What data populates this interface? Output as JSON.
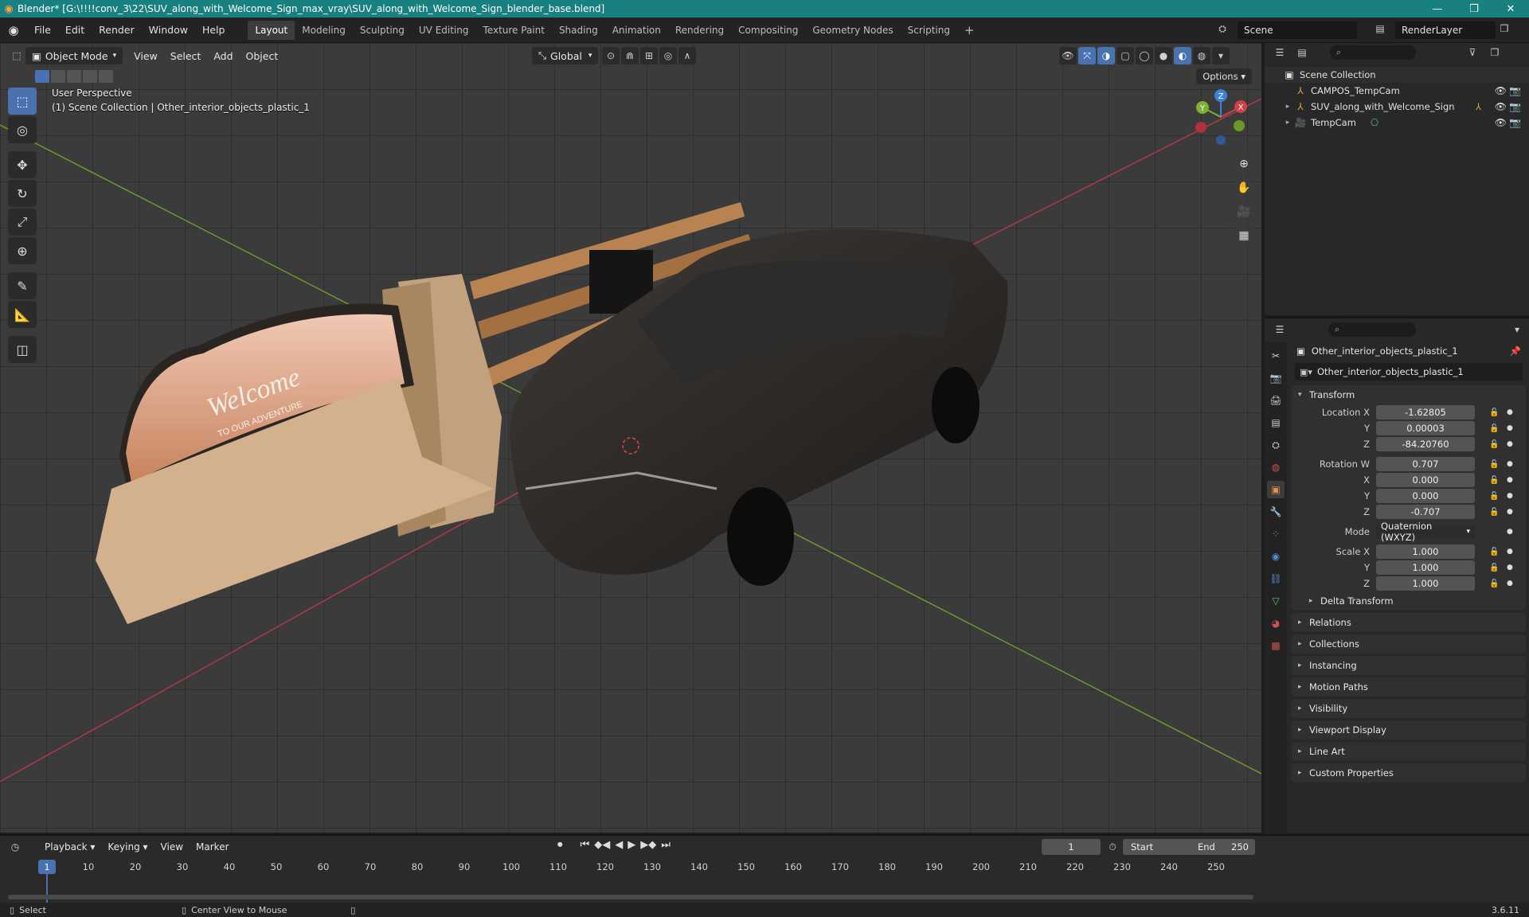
{
  "titlebar": {
    "title": "Blender* [G:\\!!!!conv_3\\22\\SUV_along_with_Welcome_Sign_max_vray\\SUV_along_with_Welcome_Sign_blender_base.blend]",
    "minimize": "—",
    "maximize": "❐",
    "close": "✕"
  },
  "menubar": {
    "menus": [
      "File",
      "Edit",
      "Render",
      "Window",
      "Help"
    ],
    "workspaces": [
      "Layout",
      "Modeling",
      "Sculpting",
      "UV Editing",
      "Texture Paint",
      "Shading",
      "Animation",
      "Rendering",
      "Compositing",
      "Geometry Nodes",
      "Scripting"
    ],
    "active_workspace": "Layout",
    "add_workspace": "+",
    "scene": "Scene",
    "view_layer": "RenderLayer"
  },
  "viewport": {
    "mode": "Object Mode",
    "menus": [
      "View",
      "Select",
      "Add",
      "Object"
    ],
    "orientation": "Global",
    "options": "Options",
    "perspective": "User Perspective",
    "collection_info": "(1) Scene Collection | Other_interior_objects_plastic_1",
    "sign_text": "Welcome",
    "sign_subtext": "TO OUR ADVENTURE",
    "gizmo": {
      "x": "X",
      "y": "Y",
      "z": "Z"
    }
  },
  "outliner": {
    "root": "Scene Collection",
    "items": [
      {
        "name": "CAMPOS_TempCam",
        "expand": ""
      },
      {
        "name": "SUV_along_with_Welcome_Sign",
        "expand": "▸"
      },
      {
        "name": "TempCam",
        "expand": "▸"
      }
    ]
  },
  "properties": {
    "object_name": "Other_interior_objects_plastic_1",
    "data_name": "Other_interior_objects_plastic_1",
    "transform_title": "Transform",
    "location": {
      "label": "Location X",
      "x": "-1.62805",
      "y": "0.00003",
      "z": "-84.20760"
    },
    "rotation": {
      "label": "Rotation W",
      "w": "0.707",
      "x": "0.000",
      "y": "0.000",
      "z": "-0.707"
    },
    "mode_label": "Mode",
    "mode_value": "Quaternion (WXYZ)",
    "scale": {
      "label": "Scale X",
      "x": "1.000",
      "y": "1.000",
      "z": "1.000"
    },
    "axis_y": "Y",
    "axis_z": "Z",
    "axis_x": "X",
    "delta_transform": "Delta Transform",
    "collapsed_panels": [
      "Relations",
      "Collections",
      "Instancing",
      "Motion Paths",
      "Visibility",
      "Viewport Display",
      "Line Art",
      "Custom Properties"
    ]
  },
  "timeline": {
    "menus": [
      "Playback",
      "Keying",
      "View",
      "Marker"
    ],
    "current_frame": "1",
    "start_label": "Start",
    "start": "1",
    "end_label": "End",
    "end": "250",
    "ticks": [
      "10",
      "20",
      "30",
      "40",
      "50",
      "60",
      "70",
      "80",
      "90",
      "100",
      "110",
      "120",
      "130",
      "140",
      "150",
      "160",
      "170",
      "180",
      "190",
      "200",
      "210",
      "220",
      "230",
      "240",
      "250"
    ],
    "playhead_label": "1"
  },
  "statusbar": {
    "select": "Select",
    "center_view": "Center View to Mouse",
    "version": "3.6.11"
  },
  "colors": {
    "accent": "#4a72b0",
    "titlebar": "#18817f",
    "axis_x": "#d0404a",
    "axis_y": "#7fb030",
    "axis_z": "#3f80d8"
  }
}
